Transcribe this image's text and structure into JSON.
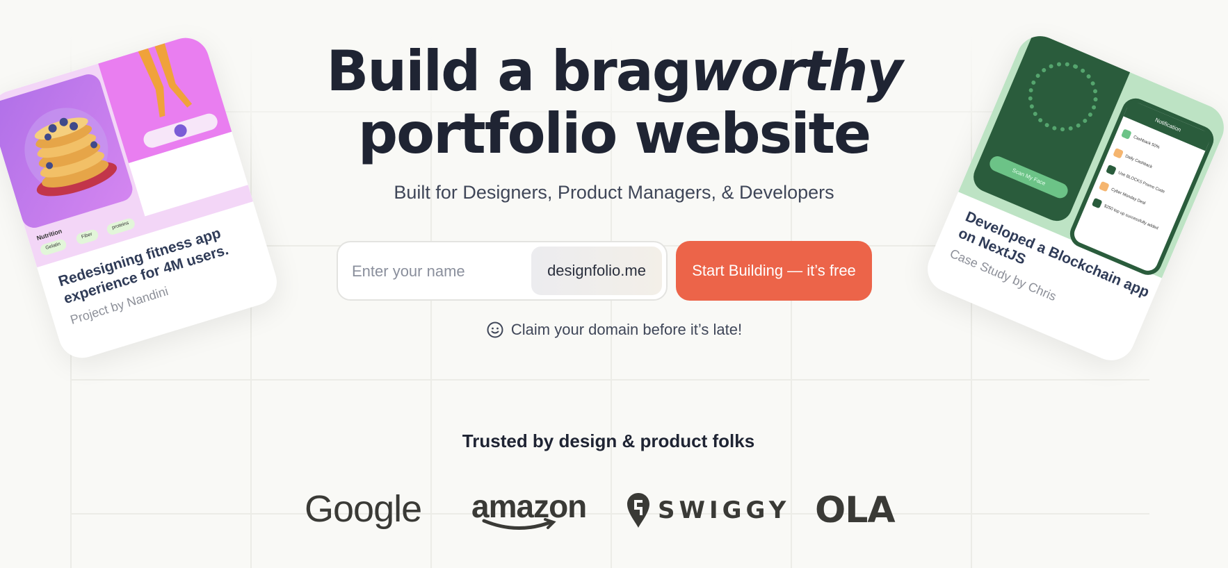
{
  "hero": {
    "title_line1_a": "Build a brag",
    "title_line1_b": "worthy",
    "title_line2": "portfolio website",
    "subtitle": "Built for Designers, Product Managers, & Developers"
  },
  "signup": {
    "name_placeholder": "Enter your name",
    "domain": "designfolio.me",
    "cta_label": "Start Building — it’s free",
    "claim_text": "Claim your domain before it’s late!"
  },
  "trusted": {
    "title": "Trusted by design & product folks",
    "logos": [
      "Google",
      "amazon",
      "SWIGGY",
      "OLA"
    ]
  },
  "card_left": {
    "title": "Redesigning fitness app experience for 4M users.",
    "subtitle": "Project by Nandini",
    "nutrition_label": "Nutrition",
    "chips": [
      "Gelatin",
      "Fiber",
      "proteins"
    ]
  },
  "card_right": {
    "title": "Developed a Blockchain app on NextJS",
    "subtitle": "Case Study by Chris",
    "scan_label": "Scan My Face",
    "notification_title": "Notification",
    "notifications": [
      "Cashback 50%",
      "Daily Cashback",
      "Use BLOCKS Promo Code",
      "Cyber Monday Deal",
      "$250 top up successfully added"
    ]
  },
  "colors": {
    "background": "#f9f9f6",
    "accent": "#ec6449",
    "text": "#1f2433"
  }
}
